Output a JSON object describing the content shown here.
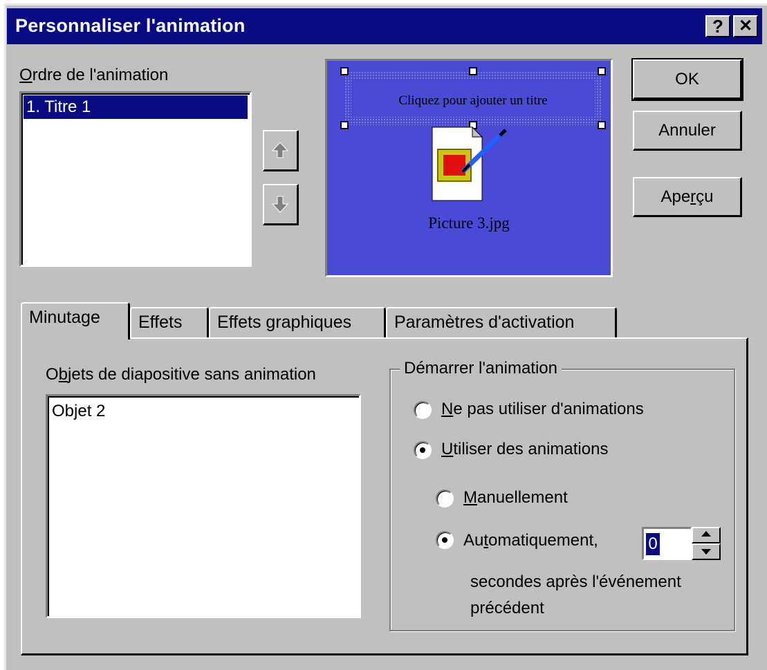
{
  "window": {
    "title": "Personnaliser l'animation",
    "help_label": "?",
    "close_label": "✕"
  },
  "animation_order": {
    "label_prefix": "O",
    "label_rest": "rdre de l'animation",
    "items": [
      "1. Titre 1"
    ]
  },
  "preview": {
    "placeholder_text": "Cliquez pour ajouter un titre",
    "picture_caption": "Picture 3.jpg"
  },
  "buttons": {
    "ok": "OK",
    "cancel": "Annuler",
    "preview_a": "Ape",
    "preview_u": "r",
    "preview_b": "çu"
  },
  "tabs": [
    {
      "label": "Minutage",
      "active": true
    },
    {
      "label": "Effets",
      "active": false
    },
    {
      "label": "Effets graphiques",
      "active": false
    },
    {
      "label": "Paramètres d'activation",
      "active": false
    }
  ],
  "timing": {
    "objects_label_a": "O",
    "objects_label_u": "b",
    "objects_label_b": "jets de diapositive sans animation",
    "objects": [
      "Objet 2"
    ],
    "start_group_title": "Démarrer l'animation",
    "options": {
      "no_anim_u": "N",
      "no_anim_rest": "e pas utiliser d'animations",
      "use_anim_u": "U",
      "use_anim_rest": "tiliser des animations",
      "manual_u": "M",
      "manual_rest": "anuellement",
      "auto_a": "Au",
      "auto_u": "t",
      "auto_b": "omatiquement,",
      "seconds_value": "0",
      "seconds_line1": "secondes après l'événement",
      "seconds_line2": "précédent"
    },
    "selected": {
      "use_animations": true,
      "automatic": true
    }
  }
}
